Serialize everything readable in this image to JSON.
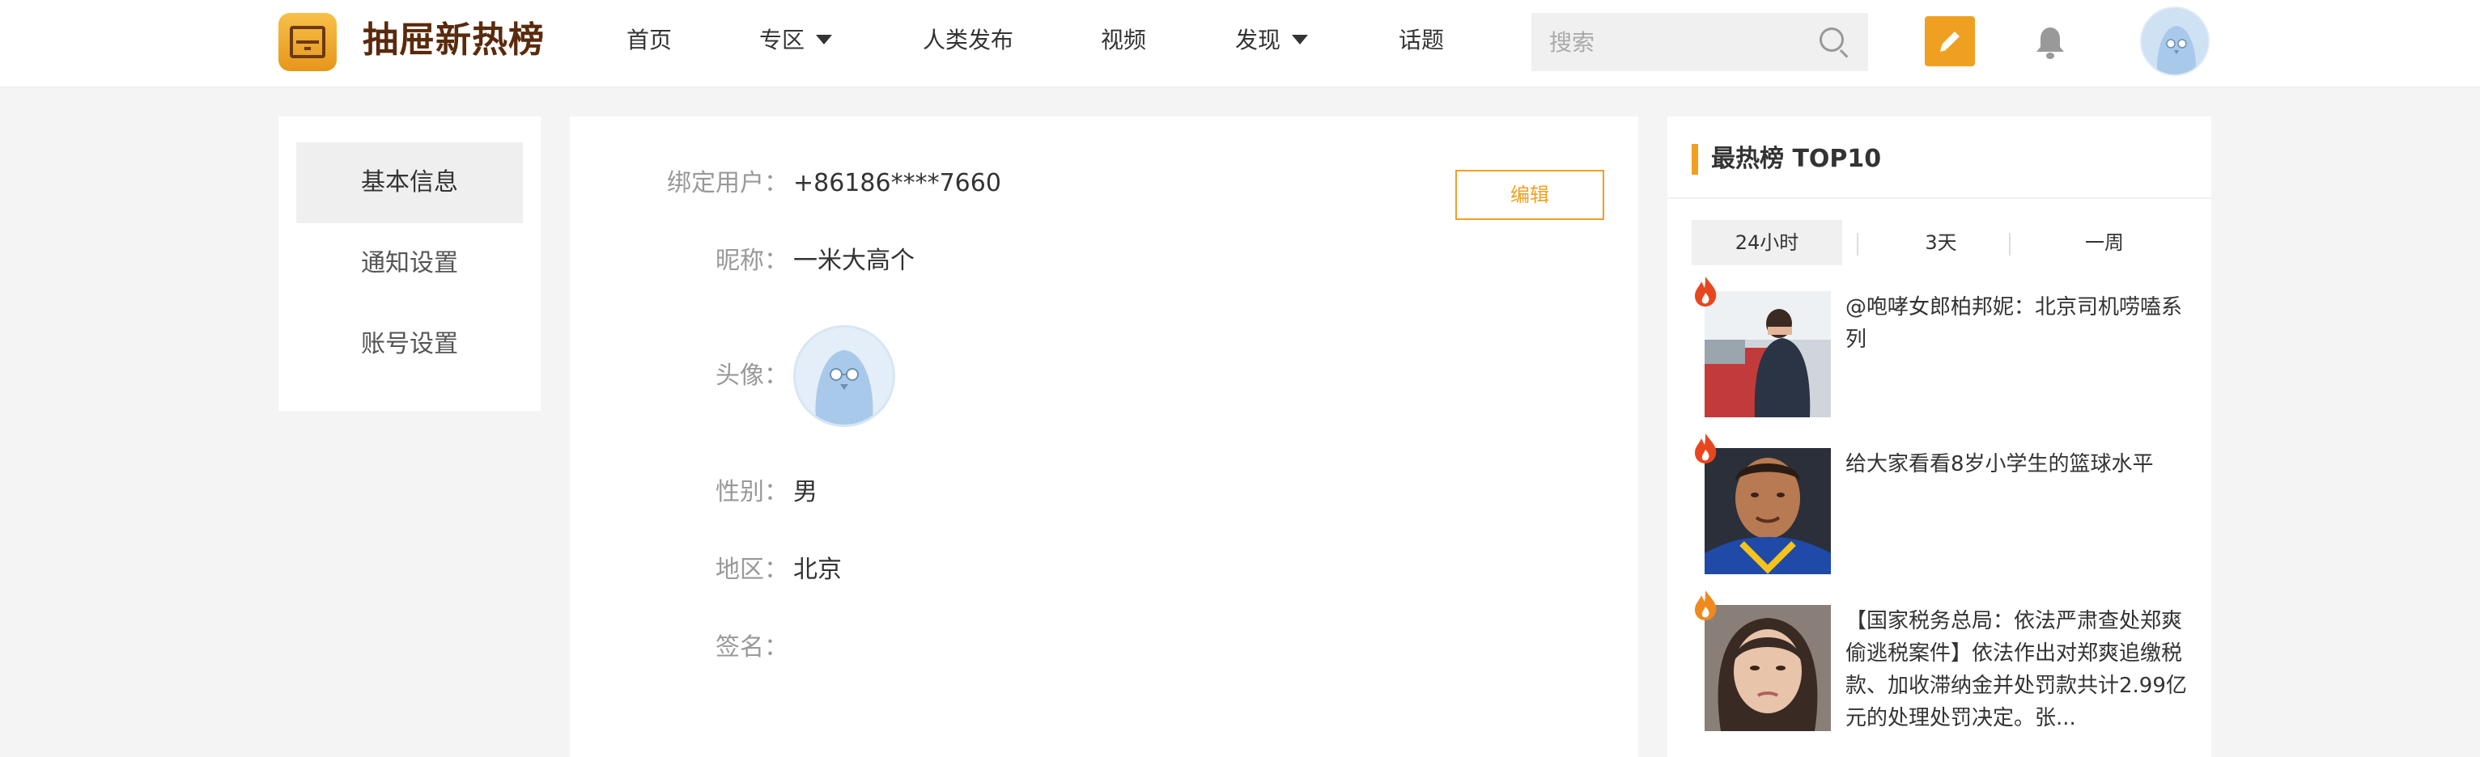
{
  "header": {
    "logo_text": "抽屉新热榜",
    "nav": [
      {
        "label": "首页"
      },
      {
        "label": "专区"
      },
      {
        "label": "人类发布"
      },
      {
        "label": "视频"
      },
      {
        "label": "发现"
      },
      {
        "label": "话题"
      }
    ],
    "search": {
      "placeholder": "搜索"
    },
    "icons": {
      "search": "search-icon",
      "publish": "pencil-icon",
      "notify": "bell-icon",
      "avatar": "avatar"
    }
  },
  "sidebar": {
    "items": [
      {
        "label": "基本信息"
      },
      {
        "label": "通知设置"
      },
      {
        "label": "账号设置"
      }
    ]
  },
  "profile": {
    "bound_user_label": "绑定用户：",
    "bound_user_value": "+86186****7660",
    "nickname_label": "昵称：",
    "nickname_value": "一米大高个",
    "avatar_label": "头像：",
    "gender_label": "性别：",
    "gender_value": "男",
    "region_label": "地区：",
    "region_value": "北京",
    "signature_label": "签名：",
    "signature_value": "",
    "edit_label": "编辑"
  },
  "ranking": {
    "title": "最热榜 TOP10",
    "tabs": [
      {
        "label": "24小时"
      },
      {
        "label": "3天"
      },
      {
        "label": "一周"
      }
    ],
    "items": [
      {
        "text": "@咆哮女郎柏邦妮：北京司机唠嗑系列"
      },
      {
        "text": "给大家看看8岁小学生的篮球水平"
      },
      {
        "text": "【国家税务总局：依法严肃查处郑爽偷逃税案件】依法作出对郑爽追缴税款、加收滞纳金并处罚款共计2.99亿元的处理处罚决定。张..."
      }
    ]
  },
  "colors": {
    "accent": "#f0a020",
    "logo_brown": "#5a2a0c",
    "flame_red": "#e8461e",
    "flame_orange": "#f08a1e"
  }
}
